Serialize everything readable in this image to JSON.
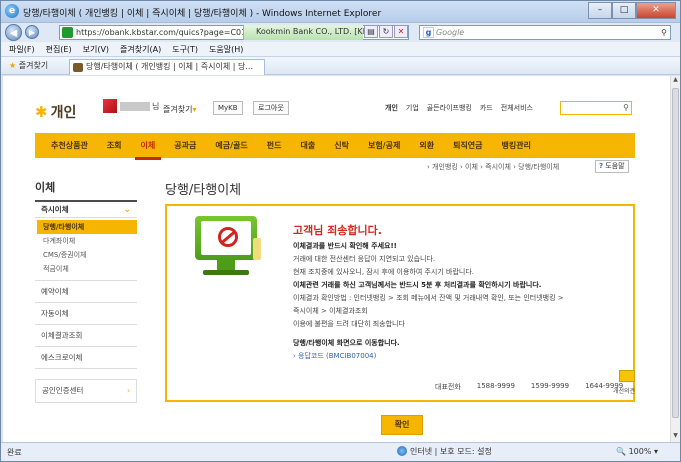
{
  "window": {
    "title": "당행/타행이체 ( 개인뱅킹 | 이체 | 즉시이체 | 당행/타행이체 ) - Windows Internet Explorer",
    "min": "–",
    "max": "□",
    "close": "✕"
  },
  "address": {
    "url": "https://obank.kbstar.com/quics?page=C01",
    "cert": "Kookmin Bank CO., LTD. [KR]",
    "search_placeholder": "Google"
  },
  "menu": [
    "파일(F)",
    "편집(E)",
    "보기(V)",
    "즐겨찾기(A)",
    "도구(T)",
    "도움말(H)"
  ],
  "favorites": {
    "label": "즐겨찾기",
    "tab_title": "당행/타행이체 ( 개인뱅킹 | 이체 | 즉시이체 | 당..."
  },
  "page": {
    "logo": "개인",
    "user_suffix": "님",
    "fav_link": "즐겨찾기",
    "mykb": "MyKB",
    "logout": "로그아웃",
    "topnav": [
      "개인",
      "기업",
      "골든라이프뱅킹",
      "카드",
      "전체서비스"
    ],
    "gnb": [
      "추천상품관",
      "조회",
      "이체",
      "공과금",
      "예금/골드",
      "펀드",
      "대출",
      "신탁",
      "보험/공제",
      "외환",
      "퇴직연금",
      "뱅킹관리"
    ],
    "breadcrumb": "› 개인뱅킹 › 이체 › 즉시이체 › 당행/타행이체",
    "help": "도움말",
    "lnb_title": "이체",
    "lnb_group": "즉시이체",
    "lnb_sub": [
      "당행/타행이체",
      "다계좌이체",
      "CMS/증권이체",
      "적금이체"
    ],
    "lnb_items": [
      "예약이체",
      "자동이체",
      "이체결과조회",
      "에스크로이체"
    ],
    "lnb_cert": "공인인증센터",
    "content_title": "당행/타행이체",
    "error": {
      "title": "고객님 죄송합니다.",
      "lines": [
        {
          "text": "이체결과를 반드시 확인해 주세요!!",
          "bold": true
        },
        {
          "text": "거래에 대한 전산센터 응답이 지연되고 있습니다.",
          "bold": false
        },
        {
          "text": "현재 조치중에 있사오니, 잠시 후에 이용하여 주시기 바랍니다.",
          "bold": false
        },
        {
          "text": "이체관련 거래를 하신 고객님께서는 반드시 5분 후 처리결과를 확인하시기 바랍니다.",
          "bold": true
        },
        {
          "text": "이체결과 확인방법 : 인터넷뱅킹 > 조회 메뉴에서 잔액 및 거래내역 확인, 또는 인터넷뱅킹 >",
          "bold": false
        },
        {
          "text": "즉시이체 > 이체결과조회",
          "bold": false
        },
        {
          "text": "이용에 불편을 드려 대단히 죄송합니다",
          "bold": false
        },
        {
          "text": "",
          "bold": false
        },
        {
          "text": "당행/타행이체 화면으로 이동합니다.",
          "bold": true
        }
      ],
      "code": "› 응답코드 (BMCIB07004)",
      "phone_label": "대표전화",
      "phones": [
        "1588-9999",
        "1599-9999",
        "1644-9999"
      ],
      "mail_label": "개선의견"
    },
    "ok": "확인"
  },
  "status": {
    "left": "완료",
    "zone": "인터넷 | 보호 모드: 설정",
    "zoom": "100%"
  }
}
